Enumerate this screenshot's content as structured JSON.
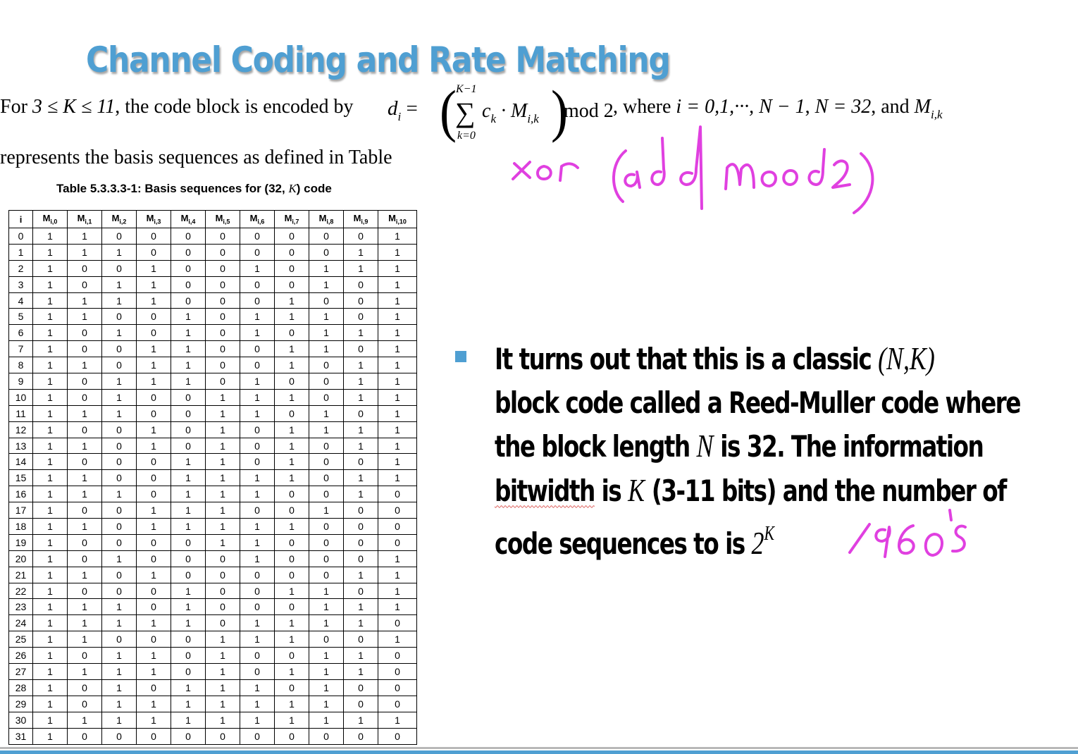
{
  "title": "Channel Coding and Rate Matching",
  "intro": {
    "for_word": "For",
    "condition": "3 ≤ K ≤ 11",
    "encoded_text": ", the code block is encoded by",
    "formula": {
      "lhs": "d",
      "lhs_sub": "i",
      "equals": "=",
      "sum_top": "K−1",
      "sigma": "∑",
      "sum_bottom": "k=0",
      "body": "c",
      "body_sub": "k",
      "dot_m": " · M",
      "m_sub": "i,k",
      "mod": "mod 2"
    },
    "where_text": ", where",
    "i_range": "i = 0,1,···, N − 1",
    "comma": ",",
    "n_value": "N = 32",
    "and_text": ", and",
    "m_symbol": "M",
    "m_symbol_sub": "i,k",
    "line2": "represents the basis sequences as defined in Table"
  },
  "table": {
    "caption_prefix": "Table 5.3.3.3-1: Basis sequences for (32,",
    "caption_k": "K",
    "caption_suffix": ") code",
    "header_i": "i",
    "header_m": "M",
    "header_subs": [
      "i,0",
      "i,1",
      "i,2",
      "i,3",
      "i,4",
      "i,5",
      "i,6",
      "i,7",
      "i,8",
      "i,9",
      "i,10"
    ],
    "rows": [
      [
        "0",
        "1",
        "1",
        "0",
        "0",
        "0",
        "0",
        "0",
        "0",
        "0",
        "0",
        "1"
      ],
      [
        "1",
        "1",
        "1",
        "1",
        "0",
        "0",
        "0",
        "0",
        "0",
        "0",
        "1",
        "1"
      ],
      [
        "2",
        "1",
        "0",
        "0",
        "1",
        "0",
        "0",
        "1",
        "0",
        "1",
        "1",
        "1"
      ],
      [
        "3",
        "1",
        "0",
        "1",
        "1",
        "0",
        "0",
        "0",
        "0",
        "1",
        "0",
        "1"
      ],
      [
        "4",
        "1",
        "1",
        "1",
        "1",
        "0",
        "0",
        "0",
        "1",
        "0",
        "0",
        "1"
      ],
      [
        "5",
        "1",
        "1",
        "0",
        "0",
        "1",
        "0",
        "1",
        "1",
        "1",
        "0",
        "1"
      ],
      [
        "6",
        "1",
        "0",
        "1",
        "0",
        "1",
        "0",
        "1",
        "0",
        "1",
        "1",
        "1"
      ],
      [
        "7",
        "1",
        "0",
        "0",
        "1",
        "1",
        "0",
        "0",
        "1",
        "1",
        "0",
        "1"
      ],
      [
        "8",
        "1",
        "1",
        "0",
        "1",
        "1",
        "0",
        "0",
        "1",
        "0",
        "1",
        "1"
      ],
      [
        "9",
        "1",
        "0",
        "1",
        "1",
        "1",
        "0",
        "1",
        "0",
        "0",
        "1",
        "1"
      ],
      [
        "10",
        "1",
        "0",
        "1",
        "0",
        "0",
        "1",
        "1",
        "1",
        "0",
        "1",
        "1"
      ],
      [
        "11",
        "1",
        "1",
        "1",
        "0",
        "0",
        "1",
        "1",
        "0",
        "1",
        "0",
        "1"
      ],
      [
        "12",
        "1",
        "0",
        "0",
        "1",
        "0",
        "1",
        "0",
        "1",
        "1",
        "1",
        "1"
      ],
      [
        "13",
        "1",
        "1",
        "0",
        "1",
        "0",
        "1",
        "0",
        "1",
        "0",
        "1",
        "1"
      ],
      [
        "14",
        "1",
        "0",
        "0",
        "0",
        "1",
        "1",
        "0",
        "1",
        "0",
        "0",
        "1"
      ],
      [
        "15",
        "1",
        "1",
        "0",
        "0",
        "1",
        "1",
        "1",
        "1",
        "0",
        "1",
        "1"
      ],
      [
        "16",
        "1",
        "1",
        "1",
        "0",
        "1",
        "1",
        "1",
        "0",
        "0",
        "1",
        "0"
      ],
      [
        "17",
        "1",
        "0",
        "0",
        "1",
        "1",
        "1",
        "0",
        "0",
        "1",
        "0",
        "0"
      ],
      [
        "18",
        "1",
        "1",
        "0",
        "1",
        "1",
        "1",
        "1",
        "1",
        "0",
        "0",
        "0"
      ],
      [
        "19",
        "1",
        "0",
        "0",
        "0",
        "0",
        "1",
        "1",
        "0",
        "0",
        "0",
        "0"
      ],
      [
        "20",
        "1",
        "0",
        "1",
        "0",
        "0",
        "0",
        "1",
        "0",
        "0",
        "0",
        "1"
      ],
      [
        "21",
        "1",
        "1",
        "0",
        "1",
        "0",
        "0",
        "0",
        "0",
        "0",
        "1",
        "1"
      ],
      [
        "22",
        "1",
        "0",
        "0",
        "0",
        "1",
        "0",
        "0",
        "1",
        "1",
        "0",
        "1"
      ],
      [
        "23",
        "1",
        "1",
        "1",
        "0",
        "1",
        "0",
        "0",
        "0",
        "1",
        "1",
        "1"
      ],
      [
        "24",
        "1",
        "1",
        "1",
        "1",
        "1",
        "0",
        "1",
        "1",
        "1",
        "1",
        "0"
      ],
      [
        "25",
        "1",
        "1",
        "0",
        "0",
        "0",
        "1",
        "1",
        "1",
        "0",
        "0",
        "1"
      ],
      [
        "26",
        "1",
        "0",
        "1",
        "1",
        "0",
        "1",
        "0",
        "0",
        "1",
        "1",
        "0"
      ],
      [
        "27",
        "1",
        "1",
        "1",
        "1",
        "0",
        "1",
        "0",
        "1",
        "1",
        "1",
        "0"
      ],
      [
        "28",
        "1",
        "0",
        "1",
        "0",
        "1",
        "1",
        "1",
        "0",
        "1",
        "0",
        "0"
      ],
      [
        "29",
        "1",
        "0",
        "1",
        "1",
        "1",
        "1",
        "1",
        "1",
        "1",
        "0",
        "0"
      ],
      [
        "30",
        "1",
        "1",
        "1",
        "1",
        "1",
        "1",
        "1",
        "1",
        "1",
        "1",
        "1"
      ],
      [
        "31",
        "1",
        "0",
        "0",
        "0",
        "0",
        "0",
        "0",
        "0",
        "0",
        "0",
        "0"
      ]
    ]
  },
  "bullet": {
    "l1_text": "It turns out that this is a classic ",
    "l1_math": "(N,K)",
    "l2_text": "block code called a Reed-Muller code where",
    "l3_text_a": "the block length ",
    "l3_math": "N",
    "l3_text_b": " is 32. The information",
    "l4_squiggle": "bitwidth",
    "l4_text_a": " is ",
    "l4_math": "K",
    "l4_text_b": " (3-11 bits) and the number of",
    "l5_text": "code sequences to is ",
    "l5_base": "2",
    "l5_exp": "K"
  },
  "annotations": {
    "color": "#e040e0",
    "note1": "xor (add mod 2)",
    "note2": "1960's"
  },
  "colors": {
    "title": "#4f9fd2",
    "bullet": "#4f9fd2",
    "ink": "#e040e0"
  }
}
